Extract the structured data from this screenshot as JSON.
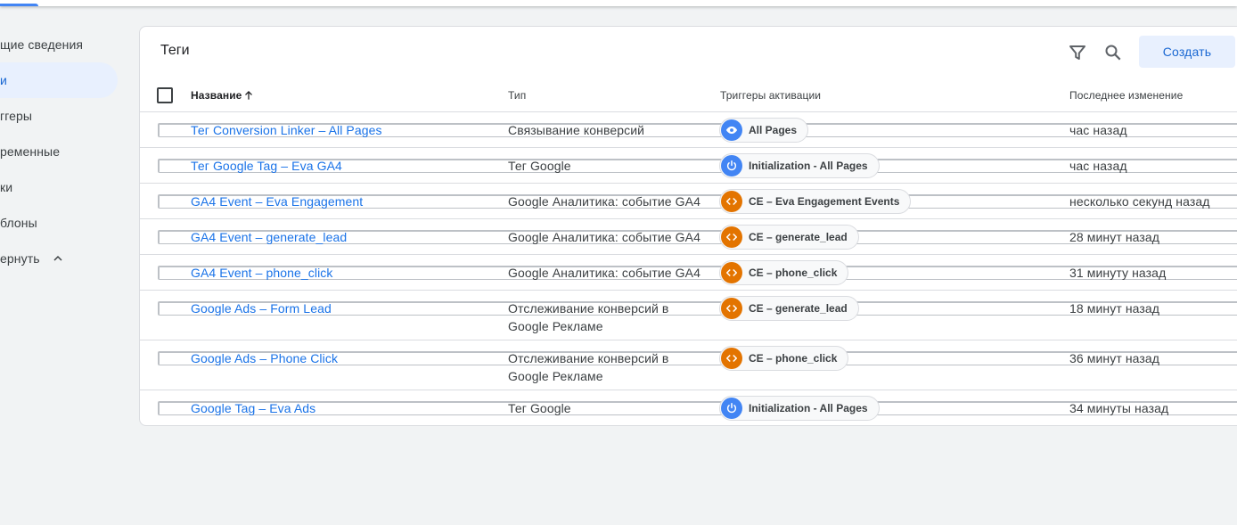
{
  "sidebar": {
    "items": [
      {
        "label": "щие сведения"
      },
      {
        "label": "и"
      },
      {
        "label": "ггеры"
      },
      {
        "label": "ременные"
      },
      {
        "label": "ки"
      },
      {
        "label": "блоны"
      },
      {
        "label": "ернуть"
      }
    ]
  },
  "card": {
    "title": "Теги",
    "create_label": "Создать"
  },
  "table": {
    "headers": {
      "name": "Название",
      "type": "Тип",
      "triggers": "Триггеры активации",
      "modified": "Последнее изменение"
    },
    "rows": [
      {
        "name": "Тег Conversion Linker – All Pages",
        "type": "Связывание конверсий",
        "trigger": "All Pages",
        "trigger_icon": "eye-icon",
        "modified": "час назад"
      },
      {
        "name": "Тег Google Tag – Eva GA4",
        "type": "Тег Google",
        "trigger": "Initialization - All Pages",
        "trigger_icon": "power-icon",
        "modified": "час назад"
      },
      {
        "name": "GA4 Event – Eva Engagement",
        "type": "Google Аналитика: событие GA4",
        "trigger": "CE – Eva Engagement Events",
        "trigger_icon": "code-icon",
        "modified": "несколько секунд назад"
      },
      {
        "name": "GA4 Event – generate_lead",
        "type": "Google Аналитика: событие GA4",
        "trigger": "CE – generate_lead",
        "trigger_icon": "code-icon",
        "modified": "28 минут назад"
      },
      {
        "name": "GA4 Event – phone_click",
        "type": "Google Аналитика: событие GA4",
        "trigger": "CE – phone_click",
        "trigger_icon": "code-icon",
        "modified": "31 минуту назад"
      },
      {
        "name": "Google Ads – Form Lead",
        "type": "Отслеживание конверсий в Google Рекламе",
        "trigger": "CE – generate_lead",
        "trigger_icon": "code-icon",
        "modified": "18 минут назад"
      },
      {
        "name": "Google Ads – Phone Click",
        "type": "Отслеживание конверсий в Google Рекламе",
        "trigger": "CE – phone_click",
        "trigger_icon": "code-icon",
        "modified": "36 минут назад"
      },
      {
        "name": "Google Tag – Eva Ads",
        "type": "Тег Google",
        "trigger": "Initialization - All Pages",
        "trigger_icon": "power-icon",
        "modified": "34 минуты назад"
      }
    ]
  },
  "colors": {
    "accent": "#1a73e8",
    "trigger_blue": "#4285f4",
    "trigger_orange": "#e37400",
    "background": "#f1f3f4"
  }
}
